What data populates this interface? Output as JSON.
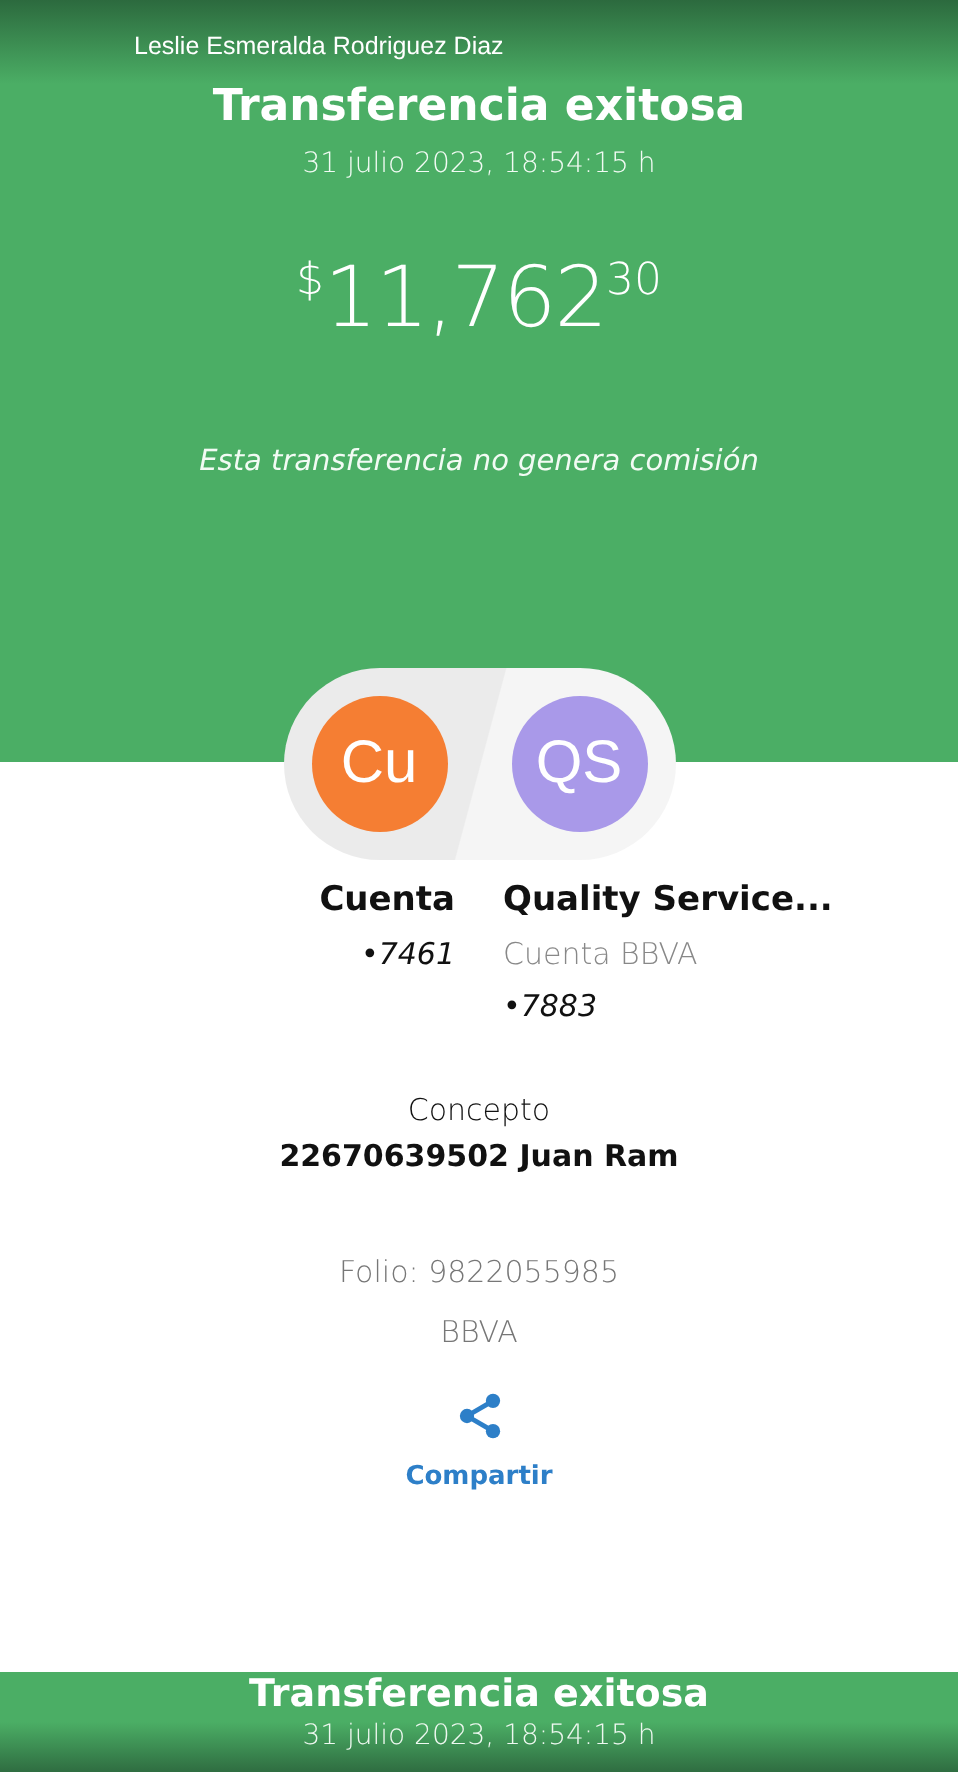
{
  "header": {
    "user_name": "Leslie Esmeralda Rodriguez Diaz",
    "title": "Transferencia exitosa",
    "datetime": "31 julio 2023, 18:54:15 h",
    "amount": {
      "currency": "$",
      "whole": "11,762",
      "cents": "30"
    },
    "note": "Esta transferencia no genera comisión"
  },
  "parties": [
    {
      "initials": "Cu",
      "color": "#f57e33",
      "name": "Cuenta",
      "lines": [
        {
          "kind": "account",
          "text": "•7461"
        }
      ]
    },
    {
      "initials": "QS",
      "color": "#a999e9",
      "name": "Quality Service...",
      "lines": [
        {
          "kind": "bank",
          "text": "Cuenta BBVA"
        },
        {
          "kind": "account",
          "text": "•7883"
        }
      ]
    }
  ],
  "concept": {
    "label": "Concepto",
    "value": "22670639502 Juan Ram"
  },
  "folio": "Folio: 9822055985",
  "bank": "BBVA",
  "share": {
    "label": "Compartir"
  },
  "footer": {
    "title": "Transferencia exitosa",
    "datetime": "31 julio 2023, 18:54:15 h"
  }
}
